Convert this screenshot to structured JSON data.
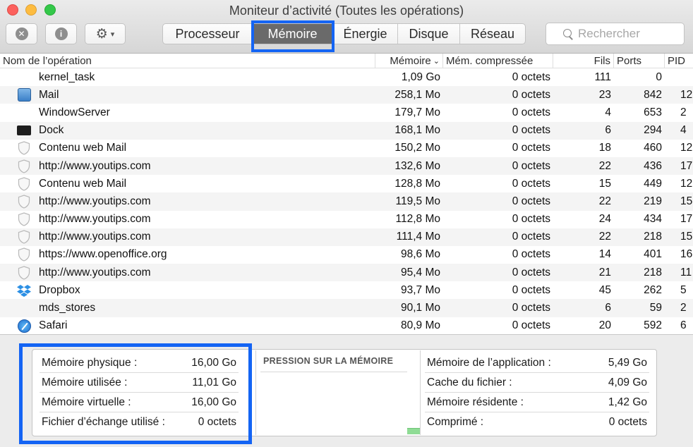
{
  "window": {
    "title": "Moniteur d’activité (Toutes les opérations)"
  },
  "toolbar": {
    "stop_icon": "stop-process-icon",
    "info_icon": "info-icon",
    "gear_icon": "gear-icon",
    "tabs": [
      {
        "label": "Processeur",
        "active": false
      },
      {
        "label": "Mémoire",
        "active": true
      },
      {
        "label": "Énergie",
        "active": false
      },
      {
        "label": "Disque",
        "active": false
      },
      {
        "label": "Réseau",
        "active": false
      }
    ],
    "search_placeholder": "Rechercher"
  },
  "table": {
    "headers": {
      "name": "Nom de l’opération",
      "memory": "Mémoire",
      "compressed": "Mém. compressée",
      "threads": "Fils",
      "ports": "Ports",
      "pid": "PID"
    },
    "rows": [
      {
        "name": "kernel_task",
        "icon": "none",
        "memory": "1,09 Go",
        "compressed": "0 octets",
        "threads": "111",
        "ports": "0",
        "pid": ""
      },
      {
        "name": "Mail",
        "icon": "mail",
        "memory": "258,1 Mo",
        "compressed": "0 octets",
        "threads": "23",
        "ports": "842",
        "pid": "12"
      },
      {
        "name": "WindowServer",
        "icon": "none",
        "memory": "179,7 Mo",
        "compressed": "0 octets",
        "threads": "4",
        "ports": "653",
        "pid": "2"
      },
      {
        "name": "Dock",
        "icon": "dock",
        "memory": "168,1 Mo",
        "compressed": "0 octets",
        "threads": "6",
        "ports": "294",
        "pid": "4"
      },
      {
        "name": "Contenu web Mail",
        "icon": "shield",
        "memory": "150,2 Mo",
        "compressed": "0 octets",
        "threads": "18",
        "ports": "460",
        "pid": "12"
      },
      {
        "name": "http://www.youtips.com",
        "icon": "shield",
        "memory": "132,6 Mo",
        "compressed": "0 octets",
        "threads": "22",
        "ports": "436",
        "pid": "17"
      },
      {
        "name": "Contenu web Mail",
        "icon": "shield",
        "memory": "128,8 Mo",
        "compressed": "0 octets",
        "threads": "15",
        "ports": "449",
        "pid": "12"
      },
      {
        "name": "http://www.youtips.com",
        "icon": "shield",
        "memory": "119,5 Mo",
        "compressed": "0 octets",
        "threads": "22",
        "ports": "219",
        "pid": "15"
      },
      {
        "name": "http://www.youtips.com",
        "icon": "shield",
        "memory": "112,8 Mo",
        "compressed": "0 octets",
        "threads": "24",
        "ports": "434",
        "pid": "17"
      },
      {
        "name": "http://www.youtips.com",
        "icon": "shield",
        "memory": "111,4 Mo",
        "compressed": "0 octets",
        "threads": "22",
        "ports": "218",
        "pid": "15"
      },
      {
        "name": "https://www.openoffice.org",
        "icon": "shield",
        "memory": "98,6 Mo",
        "compressed": "0 octets",
        "threads": "14",
        "ports": "401",
        "pid": "16"
      },
      {
        "name": "http://www.youtips.com",
        "icon": "shield",
        "memory": "95,4 Mo",
        "compressed": "0 octets",
        "threads": "21",
        "ports": "218",
        "pid": "11"
      },
      {
        "name": "Dropbox",
        "icon": "dropbox",
        "memory": "93,7 Mo",
        "compressed": "0 octets",
        "threads": "45",
        "ports": "262",
        "pid": "5"
      },
      {
        "name": "mds_stores",
        "icon": "none",
        "memory": "90,1 Mo",
        "compressed": "0 octets",
        "threads": "6",
        "ports": "59",
        "pid": "2"
      },
      {
        "name": "Safari",
        "icon": "safari",
        "memory": "80,9 Mo",
        "compressed": "0 octets",
        "threads": "20",
        "ports": "592",
        "pid": "6"
      }
    ]
  },
  "stats_left": [
    {
      "label": "Mémoire physique :",
      "value": "16,00 Go"
    },
    {
      "label": "Mémoire utilisée :",
      "value": "11,01 Go"
    },
    {
      "label": "Mémoire virtuelle :",
      "value": "16,00 Go"
    },
    {
      "label": "Fichier d’échange utilisé :",
      "value": "0 octets"
    }
  ],
  "pressure": {
    "title": "PRESSION SUR LA MÉMOIRE"
  },
  "stats_right": [
    {
      "label": "Mémoire de l’application :",
      "value": "5,49 Go"
    },
    {
      "label": "Cache du fichier :",
      "value": "4,09 Go"
    },
    {
      "label": "Mémoire résidente :",
      "value": "1,42 Go"
    },
    {
      "label": "Comprimé :",
      "value": "0 octets"
    }
  ],
  "colors": {
    "highlight": "#1464f4",
    "active_tab": "#6a6a6a",
    "pressure_green": "#8fdc95"
  }
}
